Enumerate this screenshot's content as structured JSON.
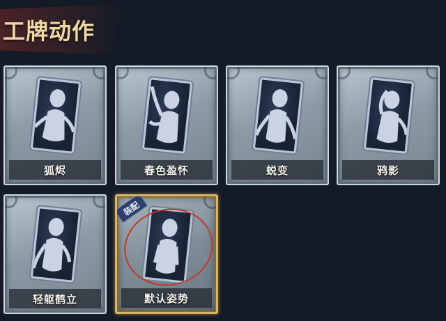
{
  "title": "工牌动作",
  "cards": [
    {
      "label": "狐烬",
      "icon": "pose-fox-icon",
      "equipped": false
    },
    {
      "label": "春色盈怀",
      "icon": "pose-spring-icon",
      "equipped": false
    },
    {
      "label": "蜕变",
      "icon": "pose-molt-icon",
      "equipped": false
    },
    {
      "label": "鸦影",
      "icon": "pose-crow-icon",
      "equipped": false
    },
    {
      "label": "轻躯鹤立",
      "icon": "pose-crane-icon",
      "equipped": false
    },
    {
      "label": "默认姿势",
      "icon": "pose-default-icon",
      "equipped": true,
      "badge": "装配"
    }
  ],
  "colors": {
    "background": "#141b26",
    "title": "#f1d9a6",
    "equipped_border": "#d8b56a",
    "badge": "#2c3e6a"
  }
}
